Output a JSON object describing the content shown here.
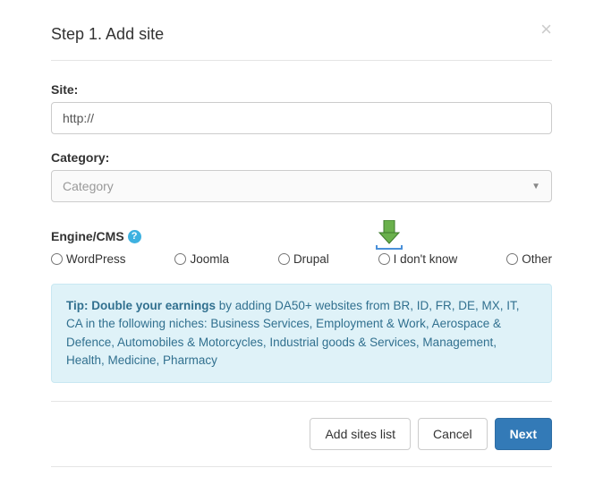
{
  "modal": {
    "title": "Step 1. Add site"
  },
  "form": {
    "site_label": "Site:",
    "site_value": "http://",
    "category_label": "Category:",
    "category_placeholder": "Category",
    "engine_label": "Engine/CMS",
    "engine_options": {
      "wordpress": "WordPress",
      "joomla": "Joomla",
      "drupal": "Drupal",
      "dontknow": "I don't know",
      "other": "Other"
    }
  },
  "tip": {
    "bold": "Tip: Double your earnings",
    "text": " by adding DA50+ websites from BR, ID, FR, DE, MX, IT, CA in the following niches: Business Services, Employment & Work, Aerospace & Defence, Automobiles & Motorcycles, Industrial goods & Services, Management, Health, Medicine, Pharmacy"
  },
  "footer": {
    "add_sites": "Add sites list",
    "cancel": "Cancel",
    "next": "Next"
  }
}
